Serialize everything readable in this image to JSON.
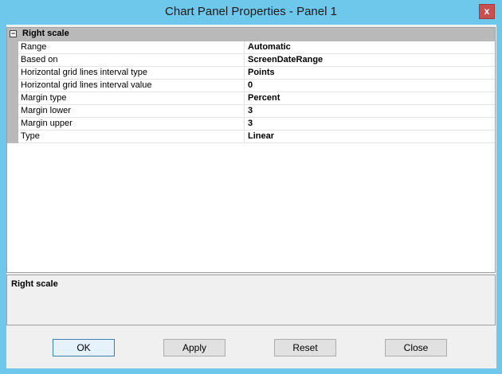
{
  "window": {
    "title": "Chart Panel Properties - Panel 1",
    "close_glyph": "x"
  },
  "category": {
    "expander": "⊟",
    "label": "Right scale"
  },
  "properties": [
    {
      "name": "Range",
      "value": "Automatic"
    },
    {
      "name": "Based on",
      "value": "ScreenDateRange"
    },
    {
      "name": "Horizontal grid lines interval type",
      "value": "Points"
    },
    {
      "name": "Horizontal grid lines interval value",
      "value": "0"
    },
    {
      "name": "Margin type",
      "value": "Percent"
    },
    {
      "name": "Margin lower",
      "value": "3"
    },
    {
      "name": "Margin upper",
      "value": "3"
    },
    {
      "name": "Type",
      "value": "Linear"
    }
  ],
  "description": {
    "title": "Right scale"
  },
  "buttons": {
    "ok": "OK",
    "apply": "Apply",
    "reset": "Reset",
    "close": "Close"
  }
}
